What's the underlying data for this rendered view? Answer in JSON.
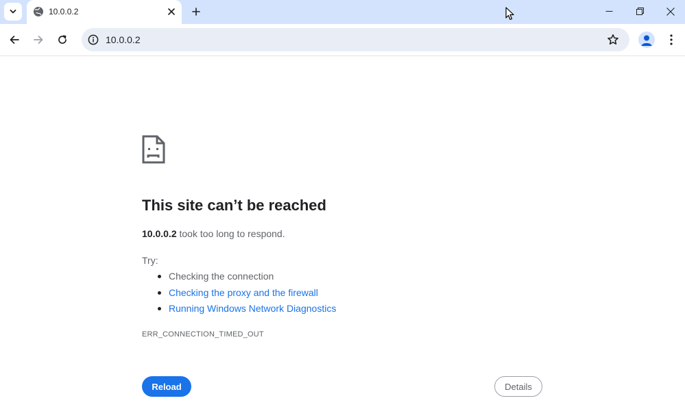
{
  "tab": {
    "title": "10.0.0.2",
    "favicon": "globe-icon"
  },
  "toolbar": {
    "url": "10.0.0.2"
  },
  "error": {
    "title": "This site can’t be reached",
    "host": "10.0.0.2",
    "message": " took too long to respond.",
    "try_label": "Try:",
    "suggestions": [
      "Checking the connection",
      "Checking the proxy and the firewall",
      "Running Windows Network Diagnostics"
    ],
    "code": "ERR_CONNECTION_TIMED_OUT",
    "reload_label": "Reload",
    "details_label": "Details"
  },
  "colors": {
    "accent": "#1a73e8",
    "titlebar": "#d3e3fd",
    "omnibox": "#e9eef6"
  }
}
